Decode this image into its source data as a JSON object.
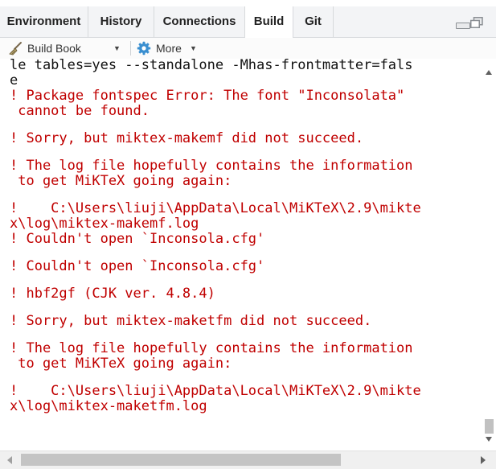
{
  "colors": {
    "error_text": "#c00000",
    "tab_bg": "#f3f4f6",
    "active_tab_bg": "#ffffff"
  },
  "tabs": [
    {
      "label": "Environment",
      "active": false
    },
    {
      "label": "History",
      "active": false
    },
    {
      "label": "Connections",
      "active": false
    },
    {
      "label": "Build",
      "active": true
    },
    {
      "label": "Git",
      "active": false
    }
  ],
  "window_controls": {
    "minimize_icon": "minimize-icon",
    "maximize_icon": "maximize-icon"
  },
  "toolbar": {
    "build_book": {
      "label": "Build Book",
      "icon": "broom-icon"
    },
    "more": {
      "label": "More",
      "icon": "gear-icon"
    }
  },
  "console": {
    "lines": [
      {
        "text": "le tables=yes --standalone -Mhas-frontmatter=fals",
        "kind": "normal"
      },
      {
        "text": "e",
        "kind": "normal"
      },
      {
        "text": "! Package fontspec Error: The font \"Inconsolata\"",
        "kind": "error"
      },
      {
        "text": " cannot be found.",
        "kind": "error"
      },
      {
        "text": "",
        "kind": "gap"
      },
      {
        "text": "! Sorry, but miktex-makemf did not succeed.",
        "kind": "error"
      },
      {
        "text": "",
        "kind": "gap"
      },
      {
        "text": "! The log file hopefully contains the information",
        "kind": "error"
      },
      {
        "text": " to get MiKTeX going again:",
        "kind": "error"
      },
      {
        "text": "",
        "kind": "gap"
      },
      {
        "text": "!    C:\\Users\\liuji\\AppData\\Local\\MiKTeX\\2.9\\mikte",
        "kind": "error"
      },
      {
        "text": "x\\log\\miktex-makemf.log",
        "kind": "error"
      },
      {
        "text": "! Couldn't open `Inconsola.cfg'",
        "kind": "error"
      },
      {
        "text": "",
        "kind": "gap"
      },
      {
        "text": "! Couldn't open `Inconsola.cfg'",
        "kind": "error"
      },
      {
        "text": "",
        "kind": "gap"
      },
      {
        "text": "! hbf2gf (CJK ver. 4.8.4)",
        "kind": "error"
      },
      {
        "text": "",
        "kind": "gap"
      },
      {
        "text": "! Sorry, but miktex-maketfm did not succeed.",
        "kind": "error"
      },
      {
        "text": "",
        "kind": "gap"
      },
      {
        "text": "! The log file hopefully contains the information",
        "kind": "error"
      },
      {
        "text": " to get MiKTeX going again:",
        "kind": "error"
      },
      {
        "text": "",
        "kind": "gap"
      },
      {
        "text": "!    C:\\Users\\liuji\\AppData\\Local\\MiKTeX\\2.9\\mikte",
        "kind": "error"
      },
      {
        "text": "x\\log\\miktex-maketfm.log",
        "kind": "error"
      }
    ]
  }
}
